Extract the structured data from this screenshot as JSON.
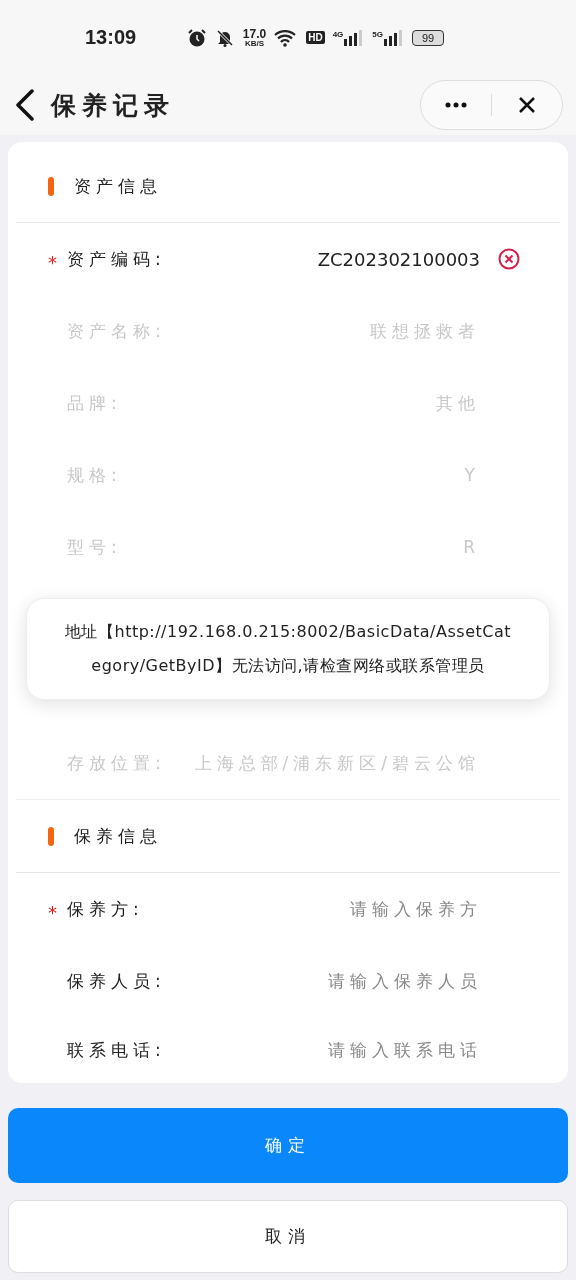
{
  "status_bar": {
    "time": "13:09",
    "speed_value": "17.0",
    "speed_unit": "KB/S",
    "hd": "HD",
    "net_a": "4G",
    "net_b": "5G",
    "battery": "99"
  },
  "header": {
    "title": "保养记录"
  },
  "required_mark": "*",
  "sections": [
    {
      "title": "资产信息",
      "fields": [
        {
          "label": "资产编码:",
          "required": true,
          "disabled": false,
          "value": "ZC202302100003",
          "clearable": true
        },
        {
          "label": "资产名称:",
          "required": false,
          "disabled": true,
          "value": "联想拯救者",
          "clearable": false
        },
        {
          "label": "品牌:",
          "required": false,
          "disabled": true,
          "value": "其他",
          "clearable": false
        },
        {
          "label": "规格:",
          "required": false,
          "disabled": true,
          "value": "Y",
          "clearable": false
        },
        {
          "label": "型号:",
          "required": false,
          "disabled": true,
          "value": "R",
          "clearable": false
        },
        {
          "label": "存放位置:",
          "required": false,
          "disabled": true,
          "value": "上海总部/浦东新区/碧云公馆",
          "clearable": false
        }
      ]
    },
    {
      "title": "保养信息",
      "fields": [
        {
          "label": "保养方:",
          "required": true,
          "disabled": false,
          "placeholder": "请输入保养方",
          "clearable": false
        },
        {
          "label": "保养人员:",
          "required": false,
          "disabled": false,
          "placeholder": "请输入保养人员",
          "clearable": false
        },
        {
          "label": "联系电话:",
          "required": false,
          "disabled": false,
          "placeholder": "请输入联系电话",
          "clearable": false
        }
      ]
    }
  ],
  "toast": {
    "message": "地址【http://192.168.0.215:8002/BasicData/AssetCategory/GetByID】无法访问,请检查网络或联系管理员"
  },
  "buttons": [
    {
      "kind": "primary",
      "label": "确定"
    },
    {
      "kind": "secondary",
      "label": "取消"
    }
  ]
}
